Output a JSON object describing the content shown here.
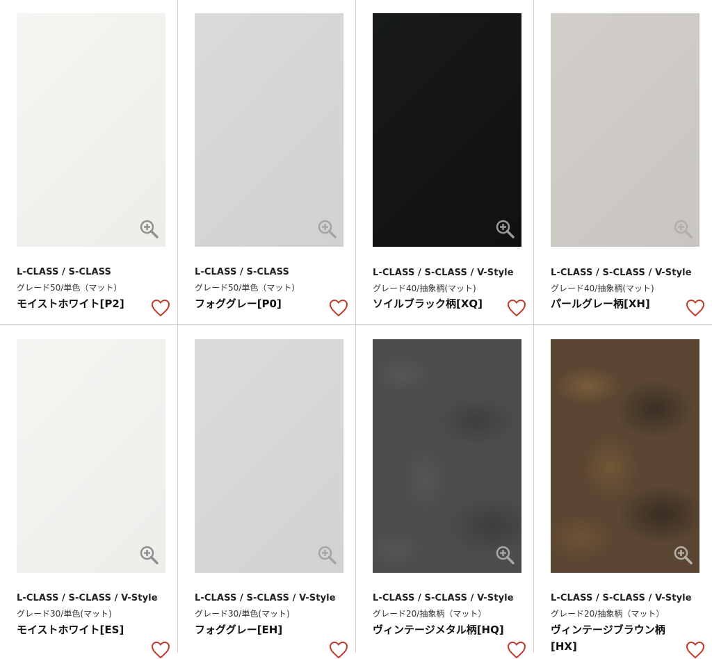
{
  "products": [
    {
      "series": "L-CLASS / S-CLASS",
      "grade": "グレード50/単色（マット）",
      "name": "モイストホワイト[P2]",
      "swatch_color": "#f3f2ee",
      "icon_zoom": "zoom-in-icon",
      "icon_fav": "heart-outline-icon"
    },
    {
      "series": "L-CLASS / S-CLASS",
      "grade": "グレード50/単色（マット）",
      "name": "フォググレー[P0]",
      "swatch_color": "#d6d6d4",
      "icon_zoom": "zoom-in-icon",
      "icon_fav": "heart-outline-icon"
    },
    {
      "series": "L-CLASS / S-CLASS / V-Style",
      "grade": "グレード40/抽象柄(マット)",
      "name": "ソイルブラック柄[XQ]",
      "swatch_color": "#141716",
      "icon_zoom": "zoom-in-icon",
      "icon_fav": "heart-outline-icon"
    },
    {
      "series": "L-CLASS / S-CLASS / V-Style",
      "grade": "グレード40/抽象柄(マット)",
      "name": "パールグレー柄[XH]",
      "swatch_color": "#cdcac5",
      "icon_zoom": "zoom-in-icon",
      "icon_fav": "heart-outline-icon"
    },
    {
      "series": "L-CLASS / S-CLASS / V-Style",
      "grade": "グレード30/単色(マット)",
      "name": "モイストホワイト[ES]",
      "swatch_color": "#f2f2ee",
      "icon_zoom": "zoom-in-icon",
      "icon_fav": "heart-outline-icon"
    },
    {
      "series": "L-CLASS / S-CLASS / V-Style",
      "grade": "グレード30/単色(マット)",
      "name": "フォググレー[EH]",
      "swatch_color": "#d7d7d5",
      "icon_zoom": "zoom-in-icon",
      "icon_fav": "heart-outline-icon"
    },
    {
      "series": "L-CLASS / S-CLASS / V-Style",
      "grade": "グレード20/抽象柄（マット）",
      "name": "ヴィンテージメタル柄[HQ]",
      "swatch_color": "#4a4c4e",
      "icon_zoom": "zoom-in-icon",
      "icon_fav": "heart-outline-icon"
    },
    {
      "series": "L-CLASS / S-CLASS / V-Style",
      "grade": "グレード20/抽象柄（マット）",
      "name": "ヴィンテージブラウン柄[HX]",
      "swatch_color": "#5a4632",
      "icon_zoom": "zoom-in-icon",
      "icon_fav": "heart-outline-icon"
    }
  ],
  "colors": {
    "heart": "#c0392b",
    "zoom_icon": "#8f8f8f",
    "divider": "#cfcfcf"
  }
}
